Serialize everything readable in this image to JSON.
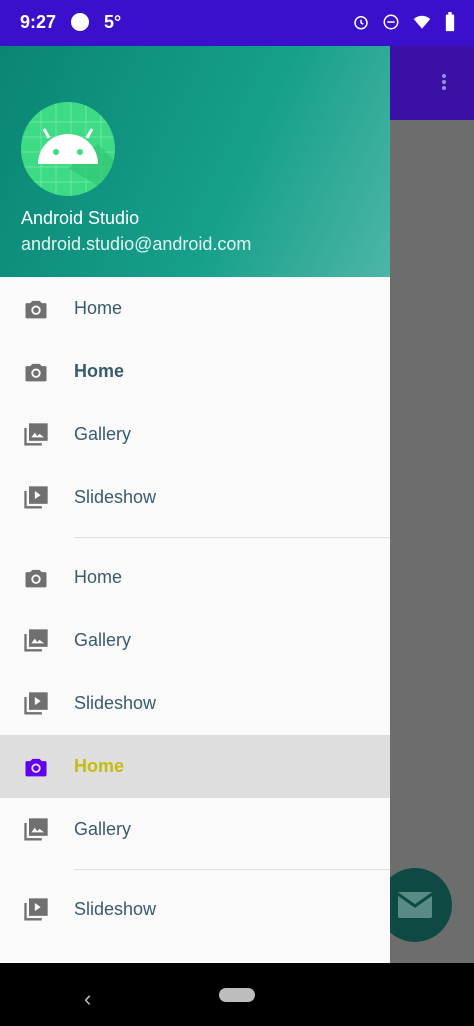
{
  "status": {
    "time": "9:27",
    "temp": "5°"
  },
  "drawer": {
    "header": {
      "name": "Android Studio",
      "email": "android.studio@android.com"
    },
    "items": [
      {
        "label": "Home",
        "icon": "camera-icon",
        "style": "normal"
      },
      {
        "label": "Home",
        "icon": "camera-icon",
        "style": "bold"
      },
      {
        "label": "Gallery",
        "icon": "gallery-icon",
        "style": "normal"
      },
      {
        "label": "Slideshow",
        "icon": "slideshow-icon",
        "style": "normal"
      },
      {
        "label": "Home",
        "icon": "camera-icon",
        "style": "normal"
      },
      {
        "label": "Gallery",
        "icon": "gallery-icon",
        "style": "normal"
      },
      {
        "label": "Slideshow",
        "icon": "slideshow-icon",
        "style": "normal"
      },
      {
        "label": "Home",
        "icon": "camera-icon",
        "style": "active"
      },
      {
        "label": "Gallery",
        "icon": "gallery-icon",
        "style": "normal"
      },
      {
        "label": "Slideshow",
        "icon": "slideshow-icon",
        "style": "normal"
      }
    ]
  },
  "colors": {
    "accent": "#3a10cc",
    "active_icon": "#6200ee",
    "active_text": "#c4bd0f",
    "header": "#0a8574"
  }
}
